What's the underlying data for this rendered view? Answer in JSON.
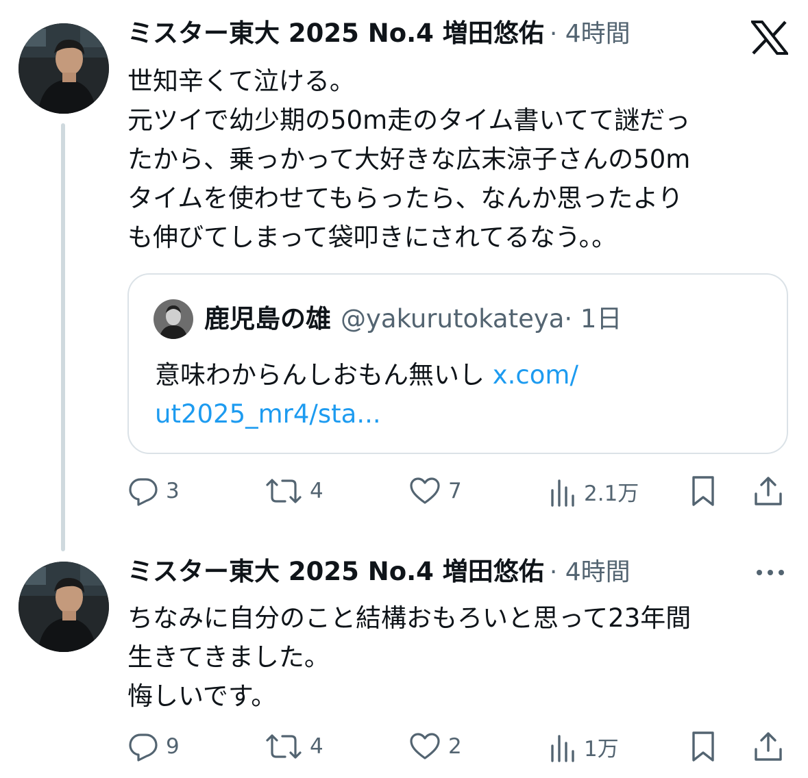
{
  "tweets": [
    {
      "display_name": "ミスター東大 2025 No.4 増田悠佑",
      "meta": "· 4時間",
      "lines": [
        "世知辛くて泣ける。",
        "元ツイで幼少期の50m走のタイム書いてて謎だっ",
        "たから、乗っかって大好きな広末涼子さんの50m",
        "タイムを使わせてもらったら、なんか思ったより",
        "も伸びてしまって袋叩きにされてるなう。。"
      ],
      "quote": {
        "name": "鹿児島の雄",
        "handle": "@yakurutokateya",
        "time": "· 1日",
        "text": "意味わからんしおもん無いし ",
        "link_line1": "x.com/",
        "link_line2": "ut2025_mr4/sta..."
      },
      "actions": {
        "replies": "3",
        "retweets": "4",
        "likes": "7",
        "views": "2.1万"
      }
    },
    {
      "display_name": "ミスター東大 2025 No.4 増田悠佑",
      "meta": "· 4時間",
      "lines": [
        "ちなみに自分のこと結構おもろいと思って23年間",
        "生きてきました。",
        "悔しいです。"
      ],
      "actions": {
        "replies": "9",
        "retweets": "4",
        "likes": "2",
        "views": "1万"
      }
    }
  ],
  "colors": {
    "text": "#0f1419",
    "secondary": "#536471",
    "link": "#1d9bf0",
    "border": "#dbe2e7",
    "thread_line": "#cfd9de"
  },
  "icons": [
    "x-logo-icon",
    "reply-icon",
    "retweet-icon",
    "like-icon",
    "views-icon",
    "bookmark-icon",
    "share-icon",
    "more-icon"
  ]
}
